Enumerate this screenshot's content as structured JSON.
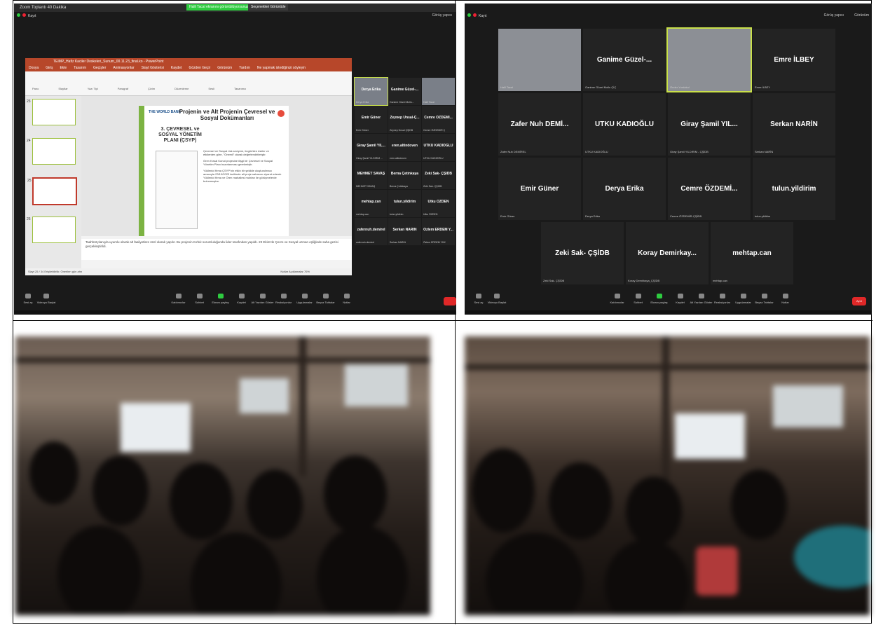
{
  "zoom1": {
    "title": "Zoom Toplantı 40 Dakika",
    "share_notice": "Halil Tacal ekranını görüntülüyorsunuz",
    "view_options": "Seçenekleri Görüntüle",
    "recording": "Kayıt",
    "ppt": {
      "title": "TEIMP_Hafiz Kaciler Doskeleri_Sunum_00.11.23_final.ko - PowerPoint",
      "user": "Buse Yalçın",
      "tabs": [
        "Dosya",
        "Giriş",
        "Ekle",
        "Tasarım",
        "Geçişler",
        "Animasyonlar",
        "Slayt Gösterisi",
        "Kaydet",
        "Gözden Geçir",
        "Görünüm",
        "Yardım",
        "Ne yapmak istediğinizi söyleyin"
      ],
      "ribbon_groups": [
        "Pano",
        "Slaytlar",
        "Yazı Tipi",
        "Paragraf",
        "Çizim",
        "Düzenleme",
        "Sesli",
        "Tasarımcı"
      ],
      "slide_numbers": [
        "23",
        "24",
        "25",
        "26"
      ],
      "slide": {
        "logo": "THE WORLD BANK",
        "title": "Projenin ve Alt Projenin Çevresel ve Sosyal Dokümanları",
        "subtitle": "3. ÇEVRESEL ve SOSYAL YÖNETİM PLANI (ÇSYP)",
        "bullets": [
          "Çevresel ve Sosyal risk seviyesi, öngörülen riskler ve etkilerden göre, \"Önemli\" olarak değerlendirilmiştir.",
          "Ören Kırsal Konut projesine ilişgi bir Çevresel ve Sosyal Yönetim Planı hazırlanması gerekmiştir.",
          "Yüklenici firma ÇSYP'nin etkin bir şekilde oluşturulması amacıyla 23/10/2023 tarihinde alt proje sahasını ziyaret ederek Yüklenici firma ve Ören mahallesi muhtarı ile görüşmelerde bulunmuştur."
        ]
      },
      "notes": "Taahhüt planıyla uyumlu olarak alt faaliyetlere özel olarak yapılır. Bu projenin Kırbık sorumluluğunda lider tarafından yapıldı. 23 Ekim'de Çevre ve Sosyal uzman eşliğinde saha gezisi gerçekleştirildi.",
      "status": "Slayt 25 / 34    Erişilebilirlik: Önerilen gün ahn",
      "status_right": "Notlar    Açıklamalar    76%"
    },
    "tiles": [
      {
        "name": "Derya Erika",
        "label": "Derya Erika",
        "video": true,
        "hl": true
      },
      {
        "name": "Ganime Güzel-...",
        "label": "Ganime Güzel Mollu..."
      },
      {
        "name": "",
        "label": "Halil Tacal",
        "video": true
      },
      {
        "name": "Emir Güner",
        "label": "Emir Güner"
      },
      {
        "name": "Zeynep Ünsal-Ç...",
        "label": "Zeynep Ünsal ÇŞİDB"
      },
      {
        "name": "Cemre ÖZDEMİ...",
        "label": "Cemre ÖZDEMİR Ç"
      },
      {
        "name": "Giray Şamil YIL...",
        "label": "Giray Şamil YILDIRIM ..."
      },
      {
        "name": "eren.altindoven",
        "label": "eren.altindoven"
      },
      {
        "name": "UTKU KADIOĞLU",
        "label": "UTKU KADIOĞLU"
      },
      {
        "name": "MEHMET SAVAŞ",
        "label": "MEHMET SAVAŞ"
      },
      {
        "name": "Berna Çetinkaya",
        "label": "Berna Çetinkaya"
      },
      {
        "name": "Zeki Sak- ÇŞİDB",
        "label": "Zeki Sak- ÇŞİDB"
      },
      {
        "name": "mehtap.can",
        "label": "mehtap.can"
      },
      {
        "name": "tulun.yildirim",
        "label": "tulun.yildirim"
      },
      {
        "name": "Utku ÖZDEN",
        "label": "Utku ÖZDEN"
      },
      {
        "name": "zafernuh.demirel",
        "label": "zafernuh.demirel"
      },
      {
        "name": "Serkan NARİN",
        "label": "Serkan NARİN"
      },
      {
        "name": "Özlem ERDEM Y...",
        "label": "Özlem ERDEM YÜK"
      }
    ],
    "toolbar": [
      "Sesi aç",
      "Videoyu Başlat",
      "Katılımcılar",
      "Sohbet",
      "Ekranı paylaş",
      "Kaydet",
      "Alt Yazıları Göster",
      "Reaksiyonlar",
      "Uygulamalar",
      "Beyaz Tahtalar",
      "Notlar"
    ],
    "top_right": "Görüş yapısı"
  },
  "zoom2": {
    "recording": "Kayıt",
    "top_right_a": "Görüş yapısı",
    "top_right_b": "Görünüm",
    "tiles": [
      {
        "name": "",
        "label": "Halil Tacal",
        "video": true
      },
      {
        "name": "Ganime Güzel-...",
        "label": "Ganime Güzel Mollu ÇİÇ"
      },
      {
        "name": "",
        "label": "Önder Yurdakul",
        "video": true,
        "hl": true
      },
      {
        "name": "Emre İLBEY",
        "label": "Emre İLBEY"
      },
      {
        "name": "Zafer Nuh DEMİ...",
        "label": "Zafer Nuh DEMİREL"
      },
      {
        "name": "UTKU KADIOĞLU",
        "label": "UTKU KADIOĞLU"
      },
      {
        "name": "Giray Şamil YIL...",
        "label": "Giray Şamil YILDIRIM - ÇŞİDB"
      },
      {
        "name": "Serkan NARİN",
        "label": "Serkan NARİN"
      },
      {
        "name": "Emir Güner",
        "label": "Emir Güner"
      },
      {
        "name": "Derya Erika",
        "label": "Derya Erika"
      },
      {
        "name": "Cemre ÖZDEMİ...",
        "label": "Cemre ÖZDEMİR-ÇŞİDB"
      },
      {
        "name": "tulun.yildirim",
        "label": "tulun.yildirim"
      },
      {
        "name": "Zeki Sak- ÇŞİDB",
        "label": "Zeki Sak- ÇŞİDB"
      },
      {
        "name": "Koray Demirkay...",
        "label": "Koray Demirkaya_ÇŞİDB"
      },
      {
        "name": "mehtap.can",
        "label": "mehtap.can"
      }
    ],
    "toolbar": [
      "Sesi aç",
      "Videoyu Başlat",
      "Katılımcılar",
      "Sohbet",
      "Ekranı paylaş",
      "Kaydet",
      "Alt Yazıları Göster",
      "Reaksiyonlar",
      "Uygulamalar",
      "Beyaz Tahtalar",
      "Notlar"
    ],
    "exit": "Ayrıl"
  }
}
